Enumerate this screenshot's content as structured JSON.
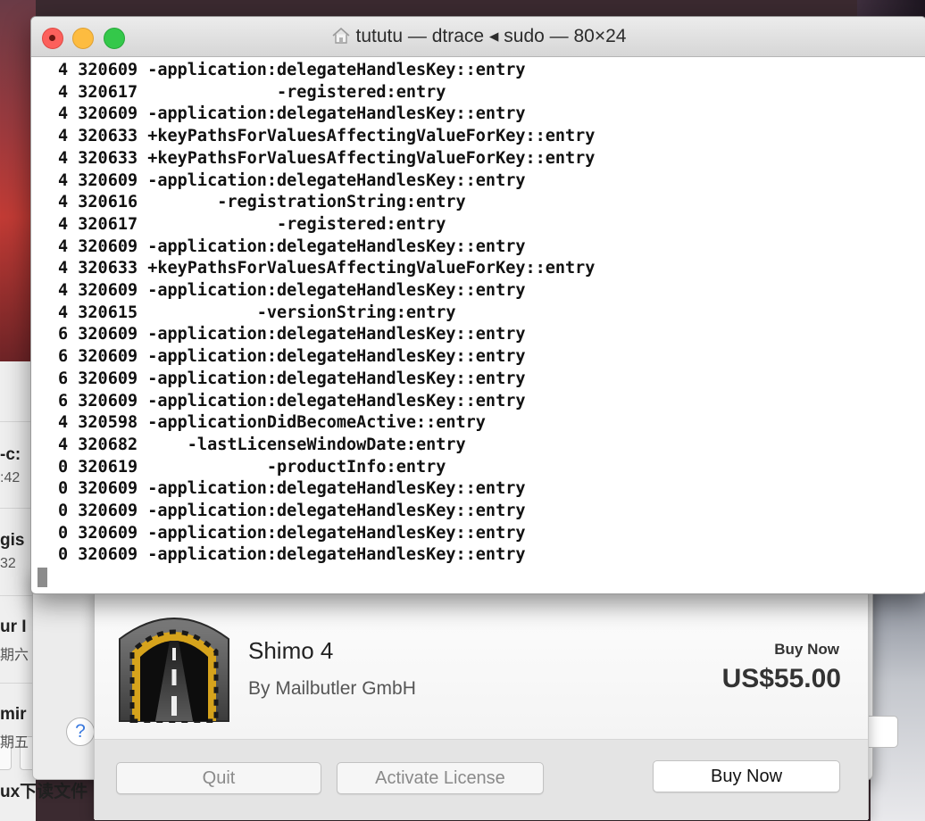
{
  "terminal": {
    "title": "tututu — dtrace ◂ sudo — 80×24",
    "lines": [
      "4 320609 -application:delegateHandlesKey::entry",
      "4 320617              -registered:entry",
      "4 320609 -application:delegateHandlesKey::entry",
      "4 320633 +keyPathsForValuesAffectingValueForKey::entry",
      "4 320633 +keyPathsForValuesAffectingValueForKey::entry",
      "4 320609 -application:delegateHandlesKey::entry",
      "4 320616        -registrationString:entry",
      "4 320617              -registered:entry",
      "4 320609 -application:delegateHandlesKey::entry",
      "4 320633 +keyPathsForValuesAffectingValueForKey::entry",
      "4 320609 -application:delegateHandlesKey::entry",
      "4 320615            -versionString:entry",
      "6 320609 -application:delegateHandlesKey::entry",
      "6 320609 -application:delegateHandlesKey::entry",
      "6 320609 -application:delegateHandlesKey::entry",
      "6 320609 -application:delegateHandlesKey::entry",
      "4 320598 -applicationDidBecomeActive::entry",
      "4 320682     -lastLicenseWindowDate:entry",
      "0 320619             -productInfo:entry",
      "0 320609 -application:delegateHandlesKey::entry",
      "0 320609 -application:delegateHandlesKey::entry",
      "0 320609 -application:delegateHandlesKey::entry",
      "0 320609 -application:delegateHandlesKey::entry"
    ]
  },
  "license_dialog": {
    "app_name": "Shimo 4",
    "vendor": "By Mailbutler GmbH",
    "buy_label": "Buy Now",
    "price": "US$55.00",
    "quit_label": "Quit",
    "activate_label": "Activate License",
    "buy_button_label": "Buy Now",
    "help_label": "?",
    "partial_button_label": "o"
  },
  "background_list": {
    "rows": [
      {
        "title": "-c:",
        "sub": ":42"
      },
      {
        "title": "gis",
        "sub": "32"
      },
      {
        "title": "ur I",
        "sub": "期六"
      },
      {
        "title": "mir",
        "sub": "期五"
      }
    ],
    "footer": "ux下读文件"
  },
  "colors": {
    "close": "#fc605c",
    "minimize": "#fdbc40",
    "zoom": "#34c84a",
    "help_accent": "#3a7ae0"
  }
}
